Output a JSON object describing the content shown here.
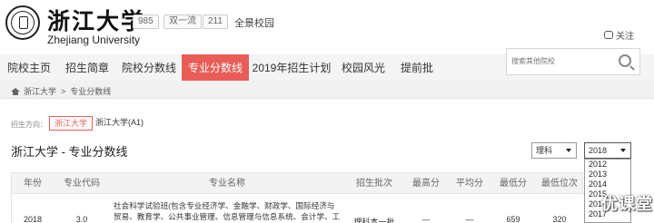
{
  "header": {
    "university_name": "浙江大学",
    "university_en": "Zhejiang University",
    "tags": [
      "985",
      "双一流",
      "211"
    ],
    "campus_link": "全景校园",
    "follow_label": "关注"
  },
  "nav": {
    "items": [
      "院校主页",
      "招生简章",
      "院校分数线",
      "专业分数线",
      "2019年招生计划",
      "校园风光",
      "提前批"
    ],
    "active_index": 3
  },
  "search": {
    "placeholder": "搜索其他院校"
  },
  "breadcrumb": [
    "浙江大学",
    ">",
    "专业分数线"
  ],
  "direction": {
    "label": "招生方向：",
    "options": [
      "浙江大学",
      "浙江大学(A1)"
    ],
    "selected_index": 0
  },
  "section_title": "浙江大学 - 专业分数线",
  "filters": {
    "type_value": "理科",
    "year_value": "2018",
    "year_options": [
      "2012",
      "2013",
      "2014",
      "2015",
      "2016",
      "2017"
    ]
  },
  "table": {
    "headers": [
      "年份",
      "专业代码",
      "专业名称",
      "招生批次",
      "最高分",
      "平均分",
      "最低分",
      "最低位次"
    ],
    "rows": [
      {
        "year": "2018",
        "code": "3.0",
        "major": "社会科学试验班(包含专业经济学、金融学、财政学、国际经济与贸易、教育学、公共事业管理、信息管理与信息系统、会计学、工商管",
        "batch": "理科本一批",
        "max": "—",
        "avg": "—",
        "min": "659",
        "min_rank": "320"
      }
    ]
  },
  "watermark": "优课堂",
  "colors": {
    "accent": "#e95d56",
    "nav_bg": "#f4f4f4"
  }
}
